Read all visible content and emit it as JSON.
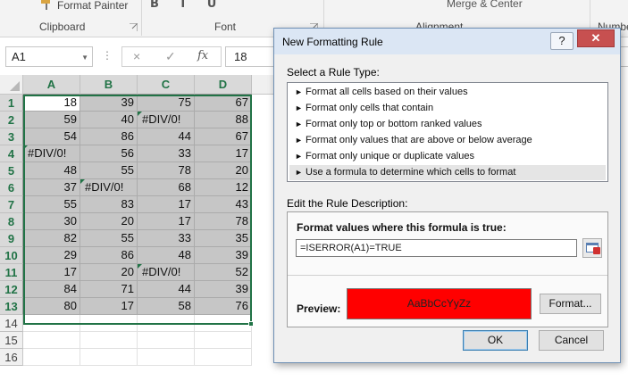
{
  "ribbon": {
    "format_painter_label": "Format Painter",
    "font_buttons": "B I U",
    "clipboard_group": "Clipboard",
    "font_group": "Font",
    "alignment_group": "Alignment",
    "merge_label": "Merge & Center",
    "number_group": "Numbe"
  },
  "formula_bar": {
    "name_box": "A1",
    "cancel_icon": "×",
    "enter_icon": "✓",
    "fx_label": "fx",
    "value": "18"
  },
  "sheet": {
    "columns": [
      "A",
      "B",
      "C",
      "D"
    ],
    "rows": [
      "1",
      "2",
      "3",
      "4",
      "5",
      "6",
      "7",
      "8",
      "9",
      "10",
      "11",
      "12",
      "13",
      "14",
      "15",
      "16"
    ],
    "cells": [
      [
        "18",
        "39",
        "75",
        "67"
      ],
      [
        "59",
        "40",
        "#DIV/0!",
        "88"
      ],
      [
        "54",
        "86",
        "44",
        "67"
      ],
      [
        "#DIV/0!",
        "56",
        "33",
        "17"
      ],
      [
        "48",
        "55",
        "78",
        "20"
      ],
      [
        "37",
        "#DIV/0!",
        "68",
        "12"
      ],
      [
        "55",
        "83",
        "17",
        "43"
      ],
      [
        "30",
        "20",
        "17",
        "78"
      ],
      [
        "82",
        "55",
        "33",
        "35"
      ],
      [
        "29",
        "86",
        "48",
        "39"
      ],
      [
        "17",
        "20",
        "#DIV/0!",
        "52"
      ],
      [
        "84",
        "71",
        "44",
        "39"
      ],
      [
        "80",
        "17",
        "58",
        "76"
      ]
    ],
    "error_indicator_color": "#217346",
    "selection_color": "#217346"
  },
  "dialog": {
    "title": "New Formatting Rule",
    "help_label": "?",
    "close_label": "✕",
    "select_rule_label": "Select a Rule Type:",
    "rule_types": [
      "Format all cells based on their values",
      "Format only cells that contain",
      "Format only top or bottom ranked values",
      "Format only values that are above or below average",
      "Format only unique or duplicate values",
      "Use a formula to determine which cells to format"
    ],
    "selected_rule_index": 5,
    "edit_rule_label": "Edit the Rule Description:",
    "formula_label": "Format values where this formula is true:",
    "formula_value": "=ISERROR(A1)=TRUE",
    "preview_label": "Preview:",
    "preview_text": "AaBbCcYyZz",
    "preview_fill_color": "#ff0000",
    "format_button": "Format...",
    "ok_button": "OK",
    "cancel_button": "Cancel"
  }
}
